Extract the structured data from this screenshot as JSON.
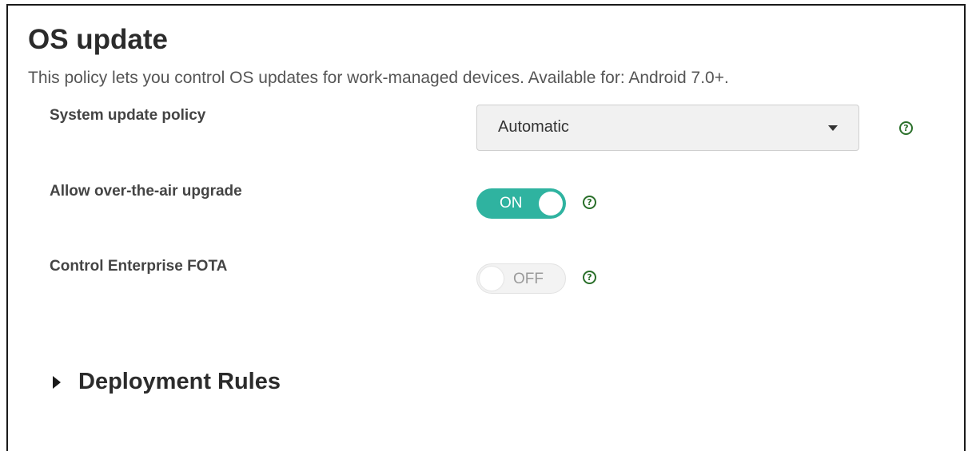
{
  "page": {
    "title": "OS update",
    "description": "This policy lets you control OS updates for work-managed devices. Available for: Android 7.0+."
  },
  "settings": {
    "system_update_policy": {
      "label": "System update policy",
      "selected": "Automatic"
    },
    "allow_ota_upgrade": {
      "label": "Allow over-the-air upgrade",
      "state": "ON"
    },
    "control_enterprise_fota": {
      "label": "Control Enterprise FOTA",
      "state": "OFF"
    }
  },
  "help_glyph": "?",
  "sections": {
    "deployment_rules": "Deployment Rules"
  },
  "colors": {
    "toggle_on": "#2fb3a0",
    "help_icon": "#2a6f2a"
  },
  "icons": {
    "dropdown": "caret-down-icon",
    "help": "help-circle-icon",
    "expand": "triangle-right-icon"
  }
}
